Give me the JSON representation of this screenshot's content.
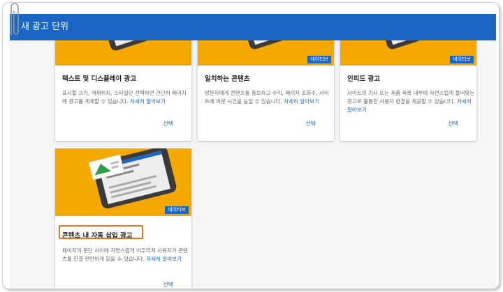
{
  "header": {
    "title": "새 광고 단위"
  },
  "cards": [
    {
      "title": "텍스트 및 디스플레이 광고",
      "desc": "표시할 크기, 게재위치, 스타일만 선택하면 간단히 페이지에 광고를 게재할 수 있습니다.",
      "link": "자세히 알아보기",
      "select": "선택"
    },
    {
      "title": "일치하는 콘텐츠",
      "desc": "방문자에게 콘텐츠를 홍보하고 수익, 페이지 조회수, 사이트에 머문 시간을 높일 수 있습니다.",
      "link": "자세히 알아보기",
      "select": "선택",
      "badge": "네이티브"
    },
    {
      "title": "인피드 광고",
      "desc": "사이트의 기사 또는 제품 목록 내부에 자연스럽게 들어맞는 광고로 훌륭한 사용자 환경을 제공할 수 있습니다.",
      "link": "자세히 알아보기",
      "select": "선택",
      "badge": "네이티브"
    },
    {
      "title": "콘텐츠 내 자동 삽입 광고",
      "desc": "페이지의 문단 사이에 자연스럽게 어우러져 사용자가 콘텐츠를 한결 편안하게 읽을 수 있습니다.",
      "link": "자세히 알아보기",
      "select": "선택",
      "badge": "네이티브"
    }
  ],
  "colors": {
    "header": "#1a66c2",
    "banner": "#f5a800",
    "highlight": "#e8731c",
    "link": "#1a66c2"
  },
  "icons": {
    "clip": "paperclip-icon",
    "illustration": "phone-illustration"
  }
}
